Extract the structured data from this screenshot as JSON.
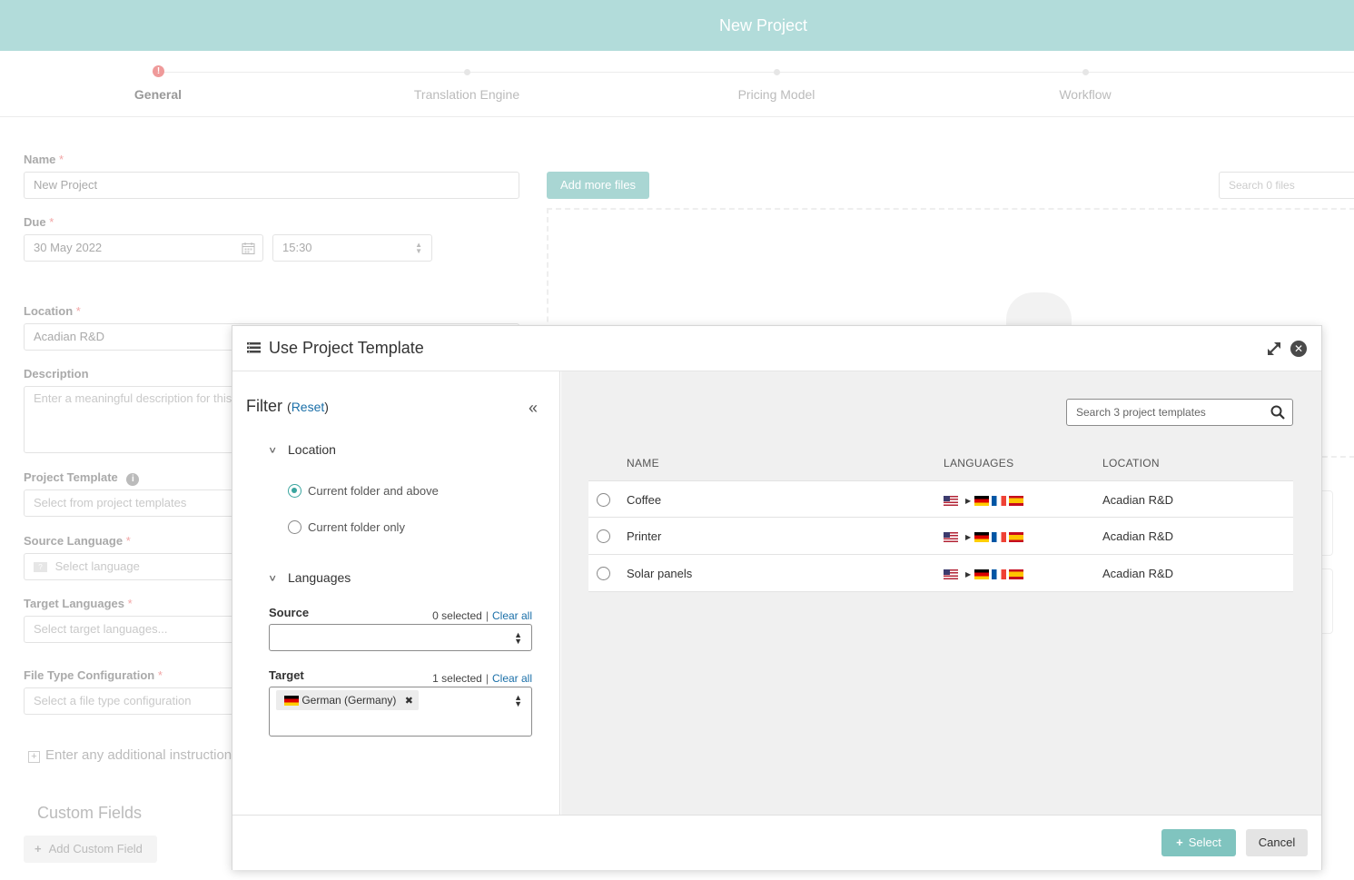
{
  "header": {
    "title": "New Project"
  },
  "stepper": {
    "steps": [
      {
        "label": "General",
        "state": "error"
      },
      {
        "label": "Translation Engine",
        "state": "pending"
      },
      {
        "label": "Pricing Model",
        "state": "pending"
      },
      {
        "label": "Workflow",
        "state": "pending"
      }
    ]
  },
  "form": {
    "name": {
      "label": "Name",
      "required": "*",
      "value": "New Project"
    },
    "due": {
      "label": "Due",
      "required": "*",
      "date": "30 May 2022",
      "time": "15:30"
    },
    "location": {
      "label": "Location",
      "required": "*",
      "value": "Acadian R&D"
    },
    "description": {
      "label": "Description",
      "placeholder": "Enter a meaningful description for this project"
    },
    "project_template": {
      "label": "Project Template",
      "placeholder": "Select from project templates"
    },
    "source_language": {
      "label": "Source Language",
      "required": "*",
      "placeholder": "Select language"
    },
    "target_languages": {
      "label": "Target Languages",
      "required": "*",
      "placeholder": "Select target languages..."
    },
    "file_type": {
      "label": "File Type Configuration",
      "required": "*",
      "placeholder": "Select a file type configuration"
    },
    "instructions": {
      "label": "Enter any additional instructions"
    },
    "custom_fields": {
      "title": "Custom Fields",
      "add_label": "Add Custom Field"
    }
  },
  "files": {
    "add_label": "Add more files",
    "search_placeholder": "Search 0 files"
  },
  "modal": {
    "title": "Use Project Template",
    "filter": {
      "title": "Filter",
      "reset_label": "Reset",
      "location": {
        "title": "Location",
        "options": [
          {
            "label": "Current folder and above",
            "selected": true
          },
          {
            "label": "Current folder only",
            "selected": false
          }
        ]
      },
      "languages": {
        "title": "Languages",
        "source": {
          "label": "Source",
          "count": "0 selected",
          "clear_label": "Clear all"
        },
        "target": {
          "label": "Target",
          "count": "1 selected",
          "clear_label": "Clear all",
          "chip": "German (Germany)"
        }
      }
    },
    "search_placeholder": "Search 3 project templates",
    "table": {
      "columns": [
        "NAME",
        "LANGUAGES",
        "LOCATION"
      ],
      "rows": [
        {
          "name": "Coffee",
          "source_flag": "us",
          "target_flags": [
            "de",
            "fr",
            "es"
          ],
          "location": "Acadian R&D"
        },
        {
          "name": "Printer",
          "source_flag": "us",
          "target_flags": [
            "de",
            "fr",
            "es"
          ],
          "location": "Acadian R&D"
        },
        {
          "name": "Solar panels",
          "source_flag": "us",
          "target_flags": [
            "de",
            "fr",
            "es"
          ],
          "location": "Acadian R&D"
        }
      ]
    },
    "buttons": {
      "select": "Select",
      "cancel": "Cancel"
    }
  },
  "colors": {
    "header": "#b2dcda",
    "accent": "#3aa59f",
    "link": "#1a6fa8",
    "primary_button": "#80c4bf"
  }
}
